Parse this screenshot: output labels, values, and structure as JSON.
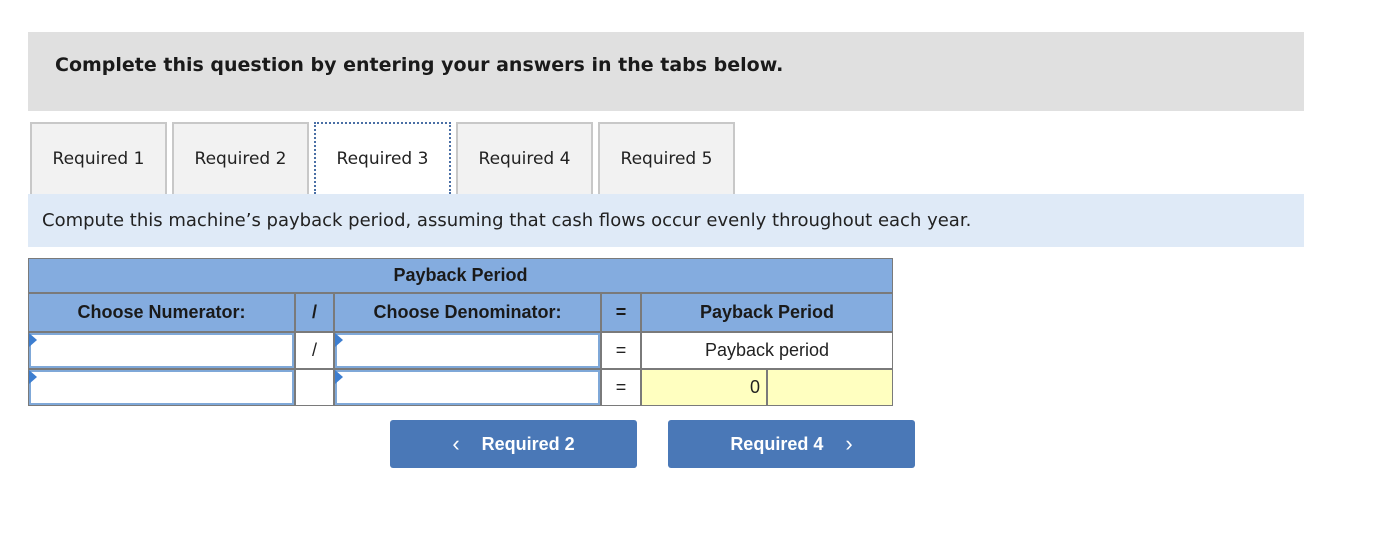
{
  "instructions": "Complete this question by entering your answers in the tabs below.",
  "tabs": [
    {
      "label": "Required 1",
      "active": false
    },
    {
      "label": "Required 2",
      "active": false
    },
    {
      "label": "Required 3",
      "active": true
    },
    {
      "label": "Required 4",
      "active": false
    },
    {
      "label": "Required 5",
      "active": false
    }
  ],
  "prompt": "Compute this machine’s payback period, assuming that cash flows occur evenly throughout each year.",
  "table": {
    "title": "Payback Period",
    "headers": {
      "numerator": "Choose Numerator:",
      "divide": "/",
      "denominator": "Choose Denominator:",
      "equals": "=",
      "result": "Payback Period"
    },
    "rows": [
      {
        "numerator": "",
        "divide": "/",
        "denominator": "",
        "equals": "=",
        "result": "Payback period"
      },
      {
        "numerator": "",
        "divide": "",
        "denominator": "",
        "equals": "=",
        "result_value": "0",
        "result_unit": ""
      }
    ]
  },
  "nav": {
    "prev_label": "Required 2",
    "prev_icon": "‹",
    "next_label": "Required 4",
    "next_icon": "›"
  }
}
